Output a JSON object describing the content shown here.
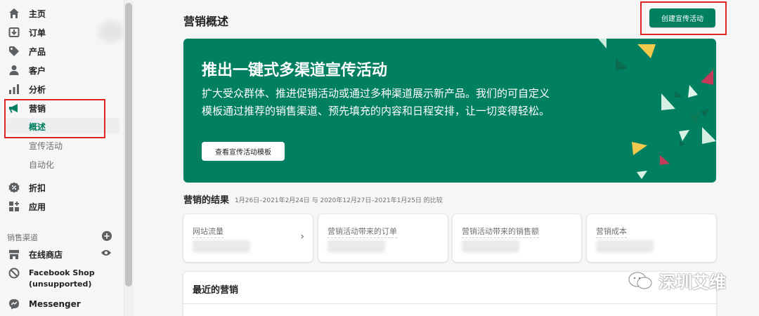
{
  "sidebar": {
    "items": [
      {
        "label": "主页",
        "icon": "home-icon"
      },
      {
        "label": "订单",
        "icon": "orders-icon"
      },
      {
        "label": "产品",
        "icon": "tag-icon"
      },
      {
        "label": "客户",
        "icon": "person-icon"
      },
      {
        "label": "分析",
        "icon": "bar-chart-icon"
      },
      {
        "label": "营销",
        "icon": "megaphone-icon"
      },
      {
        "label": "折扣",
        "icon": "discount-icon"
      },
      {
        "label": "应用",
        "icon": "apps-icon"
      }
    ],
    "marketing_sub": [
      "概述",
      "宣传活动",
      "自动化"
    ],
    "sales_channels_label": "销售渠道",
    "channels": [
      {
        "label": "在线商店",
        "icon": "store-icon"
      },
      {
        "label": "Facebook Shop\n(unsupported)",
        "icon": "blocked-icon"
      },
      {
        "label": "Messenger",
        "icon": "messenger-icon"
      }
    ]
  },
  "header": {
    "title": "营销概述",
    "create_button": "创建宣传活动"
  },
  "banner": {
    "title": "推出一键式多渠道宣传活动",
    "description": "扩大受众群体、推进促销活动或通过多种渠道展示新产品。我们的可自定义模板通过推荐的销售渠道、预先填充的内容和日程安排，让一切变得轻松。",
    "button": "查看宣传活动模板",
    "bg_color": "#008060"
  },
  "results": {
    "title": "营销的结果",
    "range": "1月26日–2021年2月24日 与 2020年12月27日–2021年1月25日 的比较",
    "cards": [
      {
        "label": "网站流量"
      },
      {
        "label": "营销活动带来的订单"
      },
      {
        "label": "营销活动带来的销售额"
      },
      {
        "label": "营销成本"
      }
    ]
  },
  "recent": {
    "title": "最近的营销"
  },
  "watermark": {
    "text": "深圳艾维"
  },
  "colors": {
    "accent": "#008060",
    "highlight_box": "#e02424"
  }
}
